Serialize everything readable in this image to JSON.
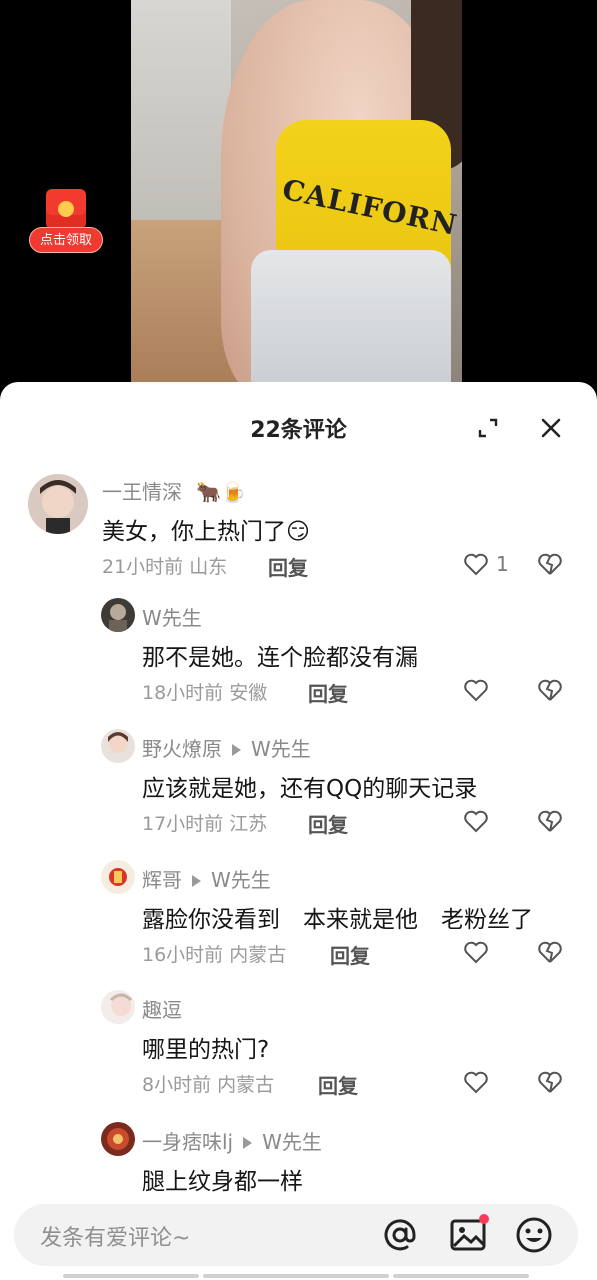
{
  "red_packet": {
    "label": "点击领取"
  },
  "video": {
    "shirt_text": "CALIFORN"
  },
  "panel": {
    "title": "22条评论"
  },
  "comments": [
    {
      "user": "一王情深",
      "badges": "🐂🍺",
      "text": "美女，你上热门了😏",
      "time": "21小时前",
      "location": "山东",
      "reply": "回复",
      "likes": "1"
    },
    {
      "user": "W先生",
      "text": "那不是她。连个脸都没有漏",
      "time": "18小时前",
      "location": "安徽",
      "reply": "回复"
    },
    {
      "user": "野火燎原",
      "reply_to": "W先生",
      "text": "应该就是她，还有QQ的聊天记录",
      "time": "17小时前",
      "location": "江苏",
      "reply": "回复"
    },
    {
      "user": "辉哥",
      "reply_to": "W先生",
      "text": "露脸你没看到　本来就是他　老粉丝了",
      "time": "16小时前",
      "location": "内蒙古",
      "reply": "回复"
    },
    {
      "user": "趣逗",
      "text": "哪里的热门?",
      "time": "8小时前",
      "location": "内蒙古",
      "reply": "回复"
    },
    {
      "user": "一身痞味lj",
      "reply_to": "W先生",
      "text": "腿上纹身都一样"
    }
  ],
  "input": {
    "placeholder": "发条有爱评论~"
  },
  "colors": {
    "accent_red": "#ef3a31",
    "text_gray": "#8a8a8a",
    "notification_dot": "#ff3b5c"
  }
}
